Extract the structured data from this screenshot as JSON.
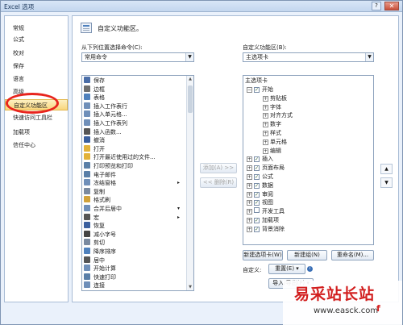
{
  "window": {
    "title": "Excel 选项",
    "help": "?",
    "close": "✕"
  },
  "nav": {
    "items": [
      "常规",
      "公式",
      "校对",
      "保存",
      "语言",
      "高级",
      "自定义功能区",
      "快速访问工具栏",
      "加载项",
      "信任中心"
    ]
  },
  "header": {
    "title": "自定义功能区。"
  },
  "left": {
    "label": "从下列位置选择命令(C):",
    "combo_value": "常用命令",
    "commands": [
      {
        "label": "保存",
        "color": "#4b6ea8"
      },
      {
        "label": "边框",
        "color": "#6f6f6f"
      },
      {
        "label": "表格",
        "color": "#4f81bd"
      },
      {
        "label": "插入工作表行",
        "color": "#6f8fb9"
      },
      {
        "label": "插入单元格...",
        "color": "#6f8fb9"
      },
      {
        "label": "插入工作表列",
        "color": "#6f8fb9"
      },
      {
        "label": "插入函数...",
        "color": "#555555"
      },
      {
        "label": "撤消",
        "color": "#3a5f9e"
      },
      {
        "label": "打开",
        "color": "#e2b23a"
      },
      {
        "label": "打开最近使用过的文件...",
        "color": "#e2b23a"
      },
      {
        "label": "打印预览和打印",
        "color": "#5a7fa8"
      },
      {
        "label": "电子邮件",
        "color": "#5a7fa8"
      },
      {
        "label": "冻结窗格",
        "color": "#6f8fb9"
      },
      {
        "label": "复制",
        "color": "#7a8aa0"
      },
      {
        "label": "格式刷",
        "color": "#d1a23b"
      },
      {
        "label": "合并后居中",
        "color": "#6f8fb9"
      },
      {
        "label": "宏",
        "color": "#555555"
      },
      {
        "label": "恢复",
        "color": "#3a5f9e"
      },
      {
        "label": "减小字号",
        "color": "#444444"
      },
      {
        "label": "剪切",
        "color": "#7a8aa0"
      },
      {
        "label": "降序排序",
        "color": "#4f81bd"
      },
      {
        "label": "居中",
        "color": "#555555"
      },
      {
        "label": "开始计算",
        "color": "#6f8fb9"
      },
      {
        "label": "快速打印",
        "color": "#5a7fa8"
      },
      {
        "label": "连接",
        "color": "#6f8fb9"
      }
    ],
    "expand_markers": [
      {
        "row": 12,
        "glyph": "▸"
      },
      {
        "row": 15,
        "glyph": "▾"
      },
      {
        "row": 16,
        "glyph": "▸"
      }
    ]
  },
  "middle": {
    "add_label": "添加(A) >>",
    "remove_label": "<< 删除(R)"
  },
  "right": {
    "label": "自定义功能区(B):",
    "combo_value": "主选项卡",
    "tree_header": "主选项卡",
    "tree": [
      {
        "label": "开始",
        "level": 0,
        "toggle": "⊟",
        "checked": true
      },
      {
        "label": "剪贴板",
        "level": 1,
        "toggle": "⊞",
        "checked": null
      },
      {
        "label": "字体",
        "level": 1,
        "toggle": "⊞",
        "checked": null
      },
      {
        "label": "对齐方式",
        "level": 1,
        "toggle": "⊞",
        "checked": null
      },
      {
        "label": "数字",
        "level": 1,
        "toggle": "⊞",
        "checked": null
      },
      {
        "label": "样式",
        "level": 1,
        "toggle": "⊞",
        "checked": null
      },
      {
        "label": "单元格",
        "level": 1,
        "toggle": "⊞",
        "checked": null
      },
      {
        "label": "编辑",
        "level": 1,
        "toggle": "⊞",
        "checked": null
      },
      {
        "label": "插入",
        "level": 0,
        "toggle": "⊞",
        "checked": true
      },
      {
        "label": "页面布局",
        "level": 0,
        "toggle": "⊞",
        "checked": true
      },
      {
        "label": "公式",
        "level": 0,
        "toggle": "⊞",
        "checked": true
      },
      {
        "label": "数据",
        "level": 0,
        "toggle": "⊞",
        "checked": true
      },
      {
        "label": "审阅",
        "level": 0,
        "toggle": "⊞",
        "checked": true
      },
      {
        "label": "视图",
        "level": 0,
        "toggle": "⊞",
        "checked": true
      },
      {
        "label": "开发工具",
        "level": 0,
        "toggle": "⊞",
        "checked": false
      },
      {
        "label": "加载项",
        "level": 0,
        "toggle": "⊞",
        "checked": true
      },
      {
        "label": "背景消除",
        "level": 0,
        "toggle": "⊞",
        "checked": true
      }
    ],
    "new_tab": "新建选项卡(W)",
    "new_group": "新建组(N)",
    "rename": "重命名(M)...",
    "customize_label": "自定义:",
    "reset": "重置(E) ▾",
    "import_export": "导入/导出(P) ▾",
    "move_up": "▲",
    "move_down": "▼"
  },
  "watermark": {
    "brand": "易采站长站",
    "url": "www.easck.com",
    "mark": "f"
  }
}
